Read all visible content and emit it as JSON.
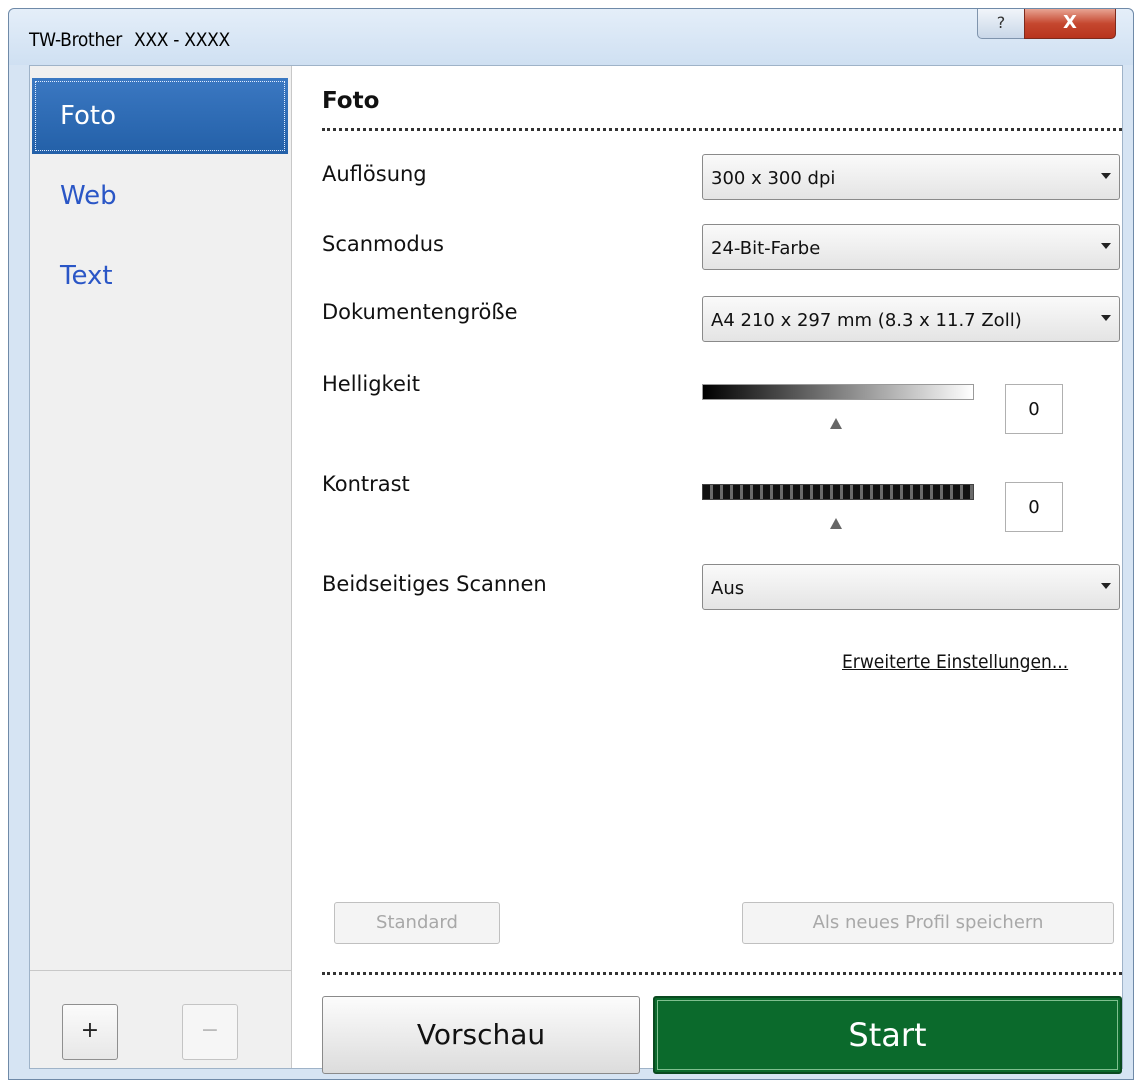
{
  "window": {
    "title": "TW-Brother",
    "model": "XXX - XXXX",
    "help_glyph": "?",
    "close_glyph": "X"
  },
  "sidebar": {
    "items": [
      {
        "label": "Foto",
        "selected": true
      },
      {
        "label": "Web",
        "selected": false
      },
      {
        "label": "Text",
        "selected": false
      }
    ],
    "add_label": "+",
    "remove_label": "−"
  },
  "panel": {
    "title": "Foto",
    "resolution": {
      "label": "Auflösung",
      "value": "300 x 300 dpi"
    },
    "scan_mode": {
      "label": "Scanmodus",
      "value": "24-Bit-Farbe"
    },
    "document_size": {
      "label": "Dokumentengröße",
      "value": "A4 210 x 297 mm (8.3 x 11.7 Zoll)"
    },
    "brightness": {
      "label": "Helligkeit",
      "value": "0"
    },
    "contrast": {
      "label": "Kontrast",
      "value": "0"
    },
    "duplex": {
      "label": "Beidseitiges Scannen",
      "value": "Aus"
    },
    "advanced_link": "Erweiterte Einstellungen...",
    "standard_button": "Standard",
    "save_profile_button": "Als neues Profil speichern",
    "preview_button": "Vorschau",
    "start_button": "Start"
  },
  "colors": {
    "accent_selected": "#2a66b3",
    "start_green": "#0b6a2c",
    "link_blue": "#2a56c6"
  }
}
